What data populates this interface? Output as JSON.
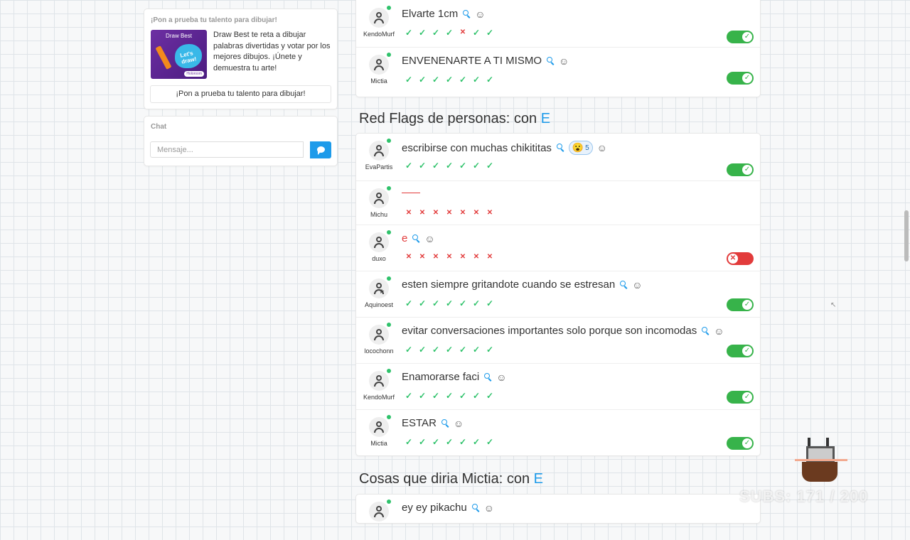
{
  "sidebar": {
    "ad": {
      "title": "¡Pon a prueba tu talento para dibujar!",
      "thumb_title": "Draw Best",
      "thumb_blob": "Let's draw!",
      "thumb_badge": "Holoroom",
      "text": "Draw Best te reta a dibujar palabras divertidas y votar por los mejores dibujos. ¡Únete y demuestra tu arte!",
      "button": "¡Pon a prueba tu talento para dibujar!"
    },
    "chat": {
      "title": "Chat",
      "placeholder": "Mensaje..."
    }
  },
  "sections": {
    "prev": {
      "entries": [
        {
          "user": "KendoMurf",
          "answer": "Elvarte 1cm",
          "votes": [
            "ok",
            "ok",
            "ok",
            "ok",
            "no",
            "ok",
            "ok"
          ],
          "toggle": "on"
        },
        {
          "user": "Mictia",
          "answer": "ENVENENARTE A TI MISMO",
          "votes": [
            "ok",
            "ok",
            "ok",
            "ok",
            "ok",
            "ok",
            "ok"
          ],
          "toggle": "on"
        }
      ]
    },
    "red_flags": {
      "title": "Red Flags de personas: con",
      "letter": "E",
      "entries": [
        {
          "user": "EvaPartis",
          "answer": "escribirse con muchas chikititas",
          "reaction_emoji": "😮",
          "reaction_count": "5",
          "votes": [
            "ok",
            "ok",
            "ok",
            "ok",
            "ok",
            "ok",
            "ok"
          ],
          "toggle": "on"
        },
        {
          "user": "Michu",
          "answer": "",
          "votes": [
            "no",
            "no",
            "no",
            "no",
            "no",
            "no",
            "no"
          ],
          "toggle": "none"
        },
        {
          "user": "duxo",
          "answer": "e",
          "votes": [
            "no",
            "no",
            "no",
            "no",
            "no",
            "no",
            "no"
          ],
          "toggle": "off"
        },
        {
          "user": "Aquinoest",
          "answer": "esten siempre gritandote cuando se estresan",
          "votes": [
            "ok",
            "ok",
            "ok",
            "ok",
            "ok",
            "ok",
            "ok"
          ],
          "toggle": "on"
        },
        {
          "user": "locochonn",
          "answer": "evitar conversaciones importantes solo porque son incomodas",
          "votes": [
            "ok",
            "ok",
            "ok",
            "ok",
            "ok",
            "ok",
            "ok"
          ],
          "toggle": "on"
        },
        {
          "user": "KendoMurf",
          "answer": "Enamorarse faci",
          "votes": [
            "ok",
            "ok",
            "ok",
            "ok",
            "ok",
            "ok",
            "ok"
          ],
          "toggle": "on"
        },
        {
          "user": "Mictia",
          "answer": "ESTAR",
          "votes": [
            "ok",
            "ok",
            "ok",
            "ok",
            "ok",
            "ok",
            "ok"
          ],
          "toggle": "on"
        }
      ]
    },
    "mictia": {
      "title": "Cosas que diria Mictia: con",
      "letter": "E",
      "entries": [
        {
          "user": "",
          "answer": "ey ey pikachu"
        }
      ]
    }
  },
  "icons": {
    "search": "search-icon",
    "emoji": "emoji-add-icon",
    "check": "check-icon",
    "cross": "cross-icon"
  },
  "colors": {
    "accent": "#1e9bea",
    "ok": "#37b34a",
    "bad": "#e23b3b"
  },
  "watermark": "SUBS: 171 / 200"
}
